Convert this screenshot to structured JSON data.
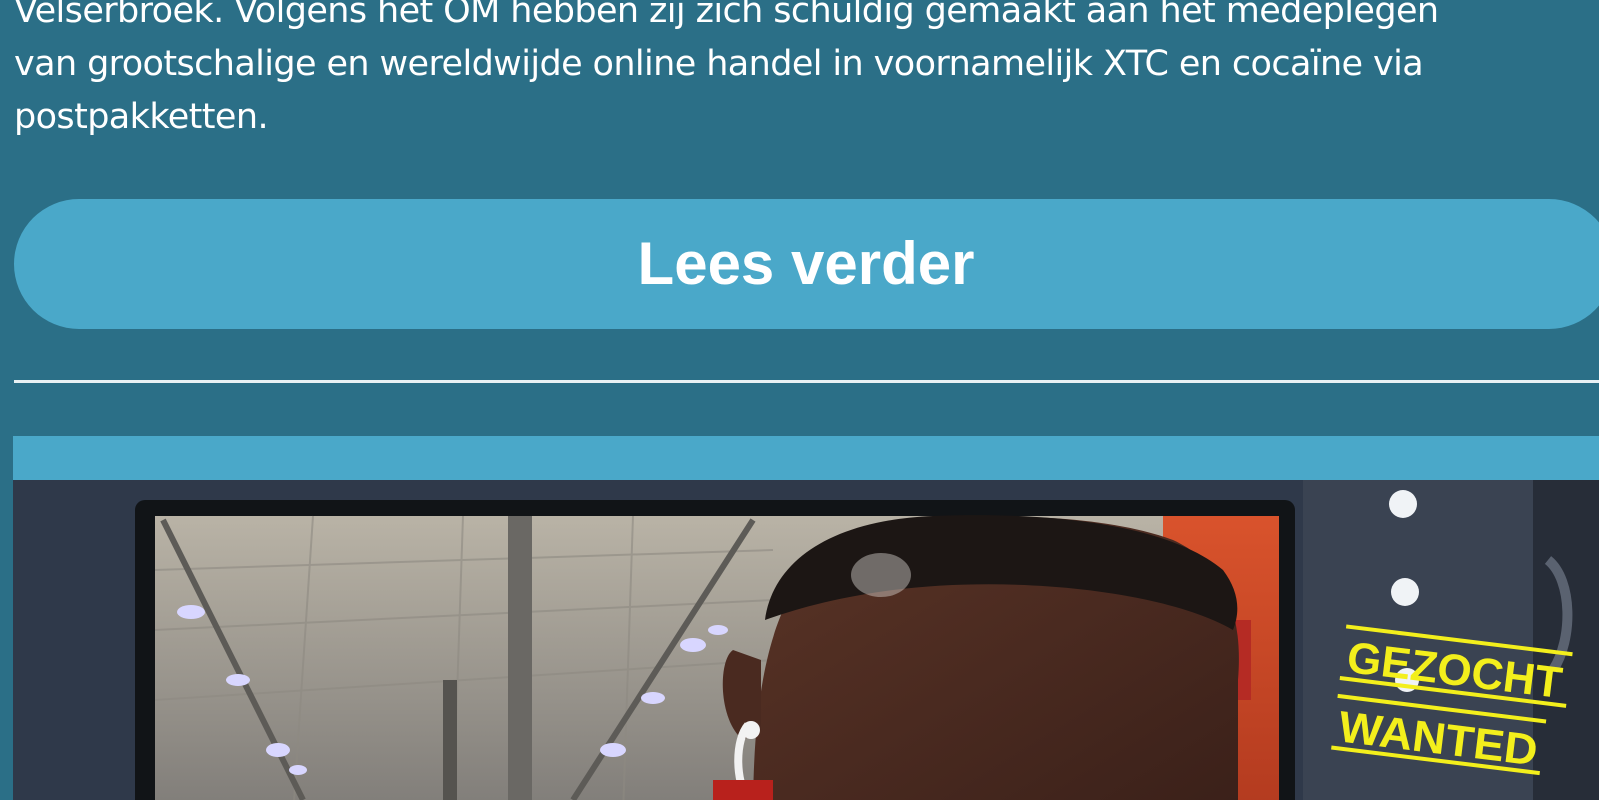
{
  "article": {
    "paragraph": "Velserbroek. Volgens het OM hebben zij zich schuldig gemaakt aan het medeplegen\nvan grootschalige en wereldwijde online handel in voornamelijk XTC en cocaïne via\npostpakketten."
  },
  "read_more": {
    "label": "Lees verder"
  },
  "teaser_image": {
    "stamp_line1": "GEZOCHT",
    "stamp_line2": "WANTED"
  },
  "colors": {
    "page_background": "#2b6f87",
    "button_background": "#4aa8c9",
    "text": "#ffffff",
    "stamp_yellow": "#f3ef1c"
  }
}
